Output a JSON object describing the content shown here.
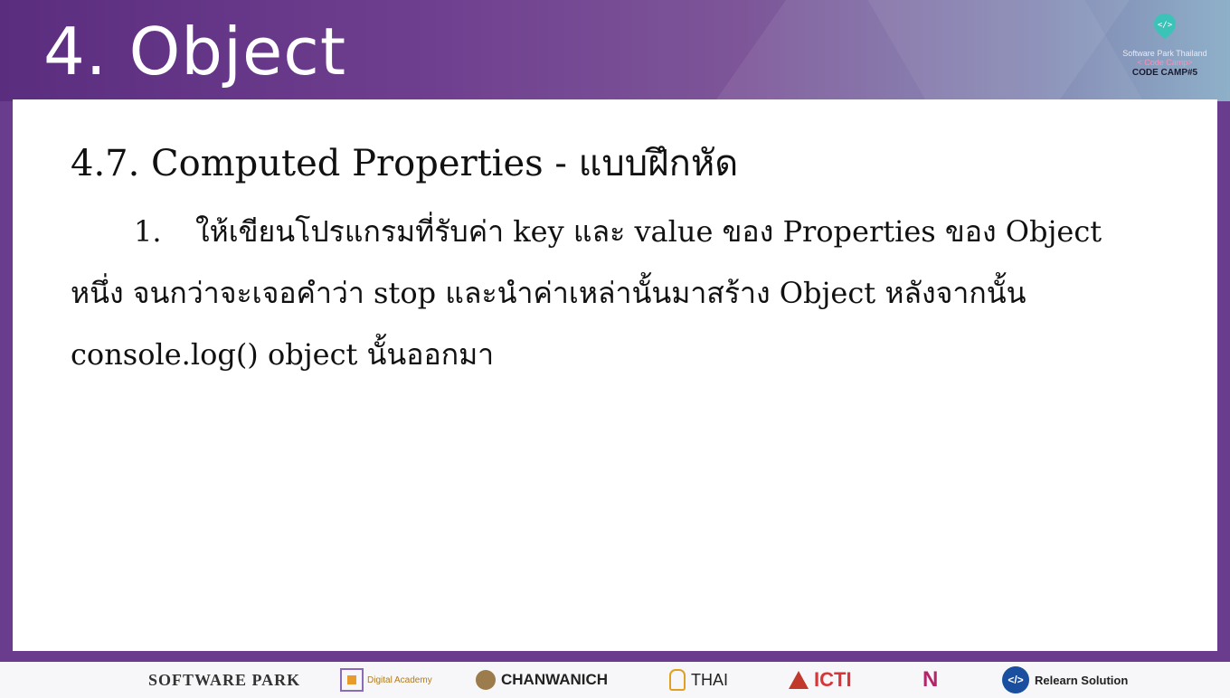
{
  "header": {
    "title": "4. Object",
    "brand": {
      "line1": "Software Park Thailand",
      "line2": "< Code Camp>",
      "line3": "CODE CAMP#5"
    }
  },
  "content": {
    "subheading": "4.7.  Computed Properties - แบบฝึกหัด",
    "item_number": "1.",
    "line1": "ให้เขียนโปรแกรมที่รับค่า key และ value ของ Properties ของ Object",
    "line2": "หนึ่ง จนกว่าจะเจอคำว่า stop และนำค่าเหล่านั้นมาสร้าง Object หลังจากนั้น",
    "line3": "console.log() object นั้นออกมา"
  },
  "footer": {
    "logos": {
      "software_park": "SOFTWARE PARK",
      "digital_academy": "Digital Academy",
      "chanwanich": "CHANWANICH",
      "thai_programmer": "THAI",
      "icti": "ICTI",
      "n": "N",
      "relearn": "Relearn Solution"
    }
  },
  "colors": {
    "header_start": "#5b2d7f",
    "header_end": "#8fb0c9",
    "accent_pink": "#ff8fb5",
    "teal_pin": "#3cc3b8"
  },
  "icons": [
    "code-pin-icon",
    "cursor-icon"
  ]
}
